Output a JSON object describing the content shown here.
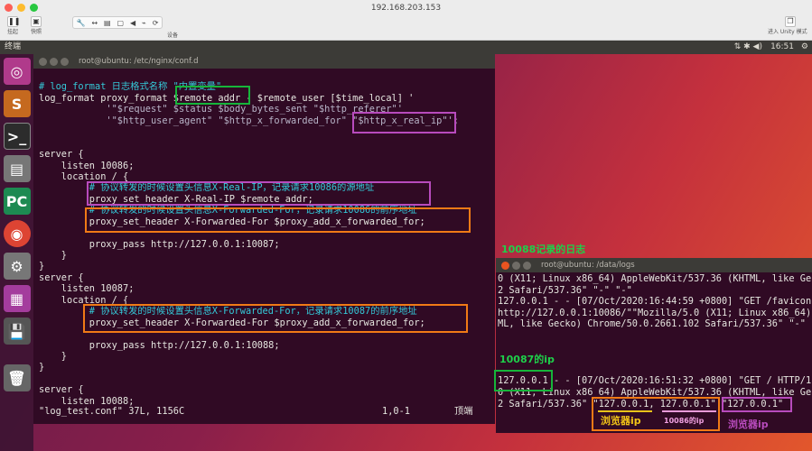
{
  "window": {
    "title": "192.168.203.153"
  },
  "toolbar": {
    "suspend": "挂起",
    "snapshot": "快照",
    "devices": "设备",
    "unity": "进入 Unity 模式"
  },
  "panel": {
    "app": "终端",
    "time": "16:51"
  },
  "terminal1": {
    "title": "root@ubuntu: /etc/nginx/conf.d",
    "lines": [
      {
        "text": " ",
        "kind": "normal"
      },
      {
        "text": "# log_format 日志格式名称 \"内置变量\"",
        "kind": "comment"
      },
      {
        "text": "log_format proxy_format $remote_addr - $remote_user [$time_local] '",
        "kind": "normal"
      },
      {
        "text": "            '\"$request\" $status $body_bytes_sent \"$http_referer\"'",
        "kind": "dim"
      },
      {
        "text": "            '\"$http_user_agent\" \"$http_x_forwarded_for\" \"$http_x_real_ip\"';",
        "kind": "dim"
      },
      {
        "text": "",
        "kind": "normal"
      },
      {
        "text": "",
        "kind": "normal"
      },
      {
        "text": "server {",
        "kind": "normal"
      },
      {
        "text": "    listen 10086;",
        "kind": "normal"
      },
      {
        "text": "    location / {",
        "kind": "normal"
      },
      {
        "text": "         # 协议转发的时候设置头信息X-Real-IP，记录请求10086的源地址",
        "kind": "comment"
      },
      {
        "text": "         proxy_set_header X-Real-IP $remote_addr;",
        "kind": "normal"
      },
      {
        "text": "         # 协议转发的时候设置头信息X-Forwarded-For，记录请求10086的前序地址",
        "kind": "comment"
      },
      {
        "text": "         proxy_set_header X-Forwarded-For $proxy_add_x_forwarded_for;",
        "kind": "normal"
      },
      {
        "text": "",
        "kind": "normal"
      },
      {
        "text": "         proxy_pass http://127.0.0.1:10087;",
        "kind": "normal"
      },
      {
        "text": "    }",
        "kind": "normal"
      },
      {
        "text": "}",
        "kind": "normal"
      },
      {
        "text": "server {",
        "kind": "normal"
      },
      {
        "text": "    listen 10087;",
        "kind": "normal"
      },
      {
        "text": "    location / {",
        "kind": "normal"
      },
      {
        "text": "         # 协议转发的时候设置头信息X-Forwarded-For，记录请求10087的前序地址",
        "kind": "comment"
      },
      {
        "text": "         proxy_set_header X-Forwarded-For $proxy_add_x_forwarded_for;",
        "kind": "normal"
      },
      {
        "text": "",
        "kind": "normal"
      },
      {
        "text": "         proxy_pass http://127.0.0.1:10088;",
        "kind": "normal"
      },
      {
        "text": "    }",
        "kind": "normal"
      },
      {
        "text": "}",
        "kind": "normal"
      },
      {
        "text": "",
        "kind": "normal"
      },
      {
        "text": "server {",
        "kind": "normal"
      },
      {
        "text": "    listen 10088;",
        "kind": "normal"
      }
    ],
    "status_file": "\"log_test.conf\" 37L, 1156C",
    "status_pos": "1,0-1",
    "status_scroll": "顶端"
  },
  "terminal2": {
    "title": "root@ubuntu: /data/logs",
    "lines": [
      "0 (X11; Linux x86_64) AppleWebKit/537.36 (KHTML, like Ge",
      "2 Safari/537.36\" \"-\" \"-\"",
      "127.0.0.1 - - [07/Oct/2020:16:44:59 +0800] \"GET /favicon",
      "http://127.0.0.1:10086/\"\"Mozilla/5.0 (X11; Linux x86_64)",
      "ML, like Gecko) Chrome/50.0.2661.102 Safari/537.36\" \"-\"",
      "",
      "",
      "",
      "",
      "127.0.0.1 - - [07/Oct/2020:16:51:32 +0800] \"GET / HTTP/1",
      "0 (X11; Linux x86_64) AppleWebKit/537.36 (KHTML, like Ge",
      "2 Safari/537.36\" \"127.0.0.1, 127.0.0.1\" \"127.0.0.1\""
    ]
  },
  "annotations": {
    "log_10088": "10088记录的日志",
    "ip_10087": "10087的ip",
    "browser_ip_1": "浏览器ip",
    "ip_10086": "10086的ip",
    "browser_ip_2": "浏览器ip"
  }
}
